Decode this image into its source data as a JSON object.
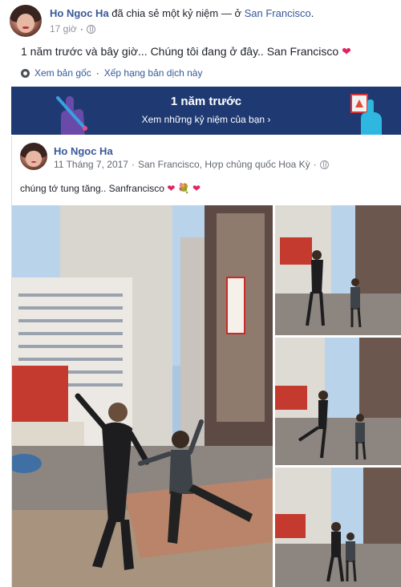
{
  "post": {
    "author": "Ho Ngoc Ha",
    "action": "đã chia sẻ một kỷ niệm — ở",
    "location": "San Francisco",
    "location_suffix": ".",
    "time": "17 giờ",
    "text": "1 năm trước và bây giờ... Chúng tôi đang ở đây.. San Francisco",
    "see_original": "Xem bản gốc",
    "rate_translation": "Xếp hạng bản dịch này"
  },
  "memory": {
    "title": "1 năm trước",
    "subtitle": "Xem những kỷ niệm của bạn ›"
  },
  "shared": {
    "author": "Ho Ngoc Ha",
    "date": "11 Tháng 7, 2017",
    "separator": "·",
    "location": "San Francisco, Hợp chủng quốc Hoa Kỳ",
    "text": "chúng tớ tung tăng.. Sanfrancisco",
    "emoji_heart": "❤",
    "emoji_flower": "💐"
  },
  "icons": {
    "globe": "globe-icon",
    "gear": "gear-icon",
    "heart": "heart-icon"
  },
  "colors": {
    "link": "#385898",
    "banner": "#1f3a72",
    "heart": "#e0245e"
  }
}
